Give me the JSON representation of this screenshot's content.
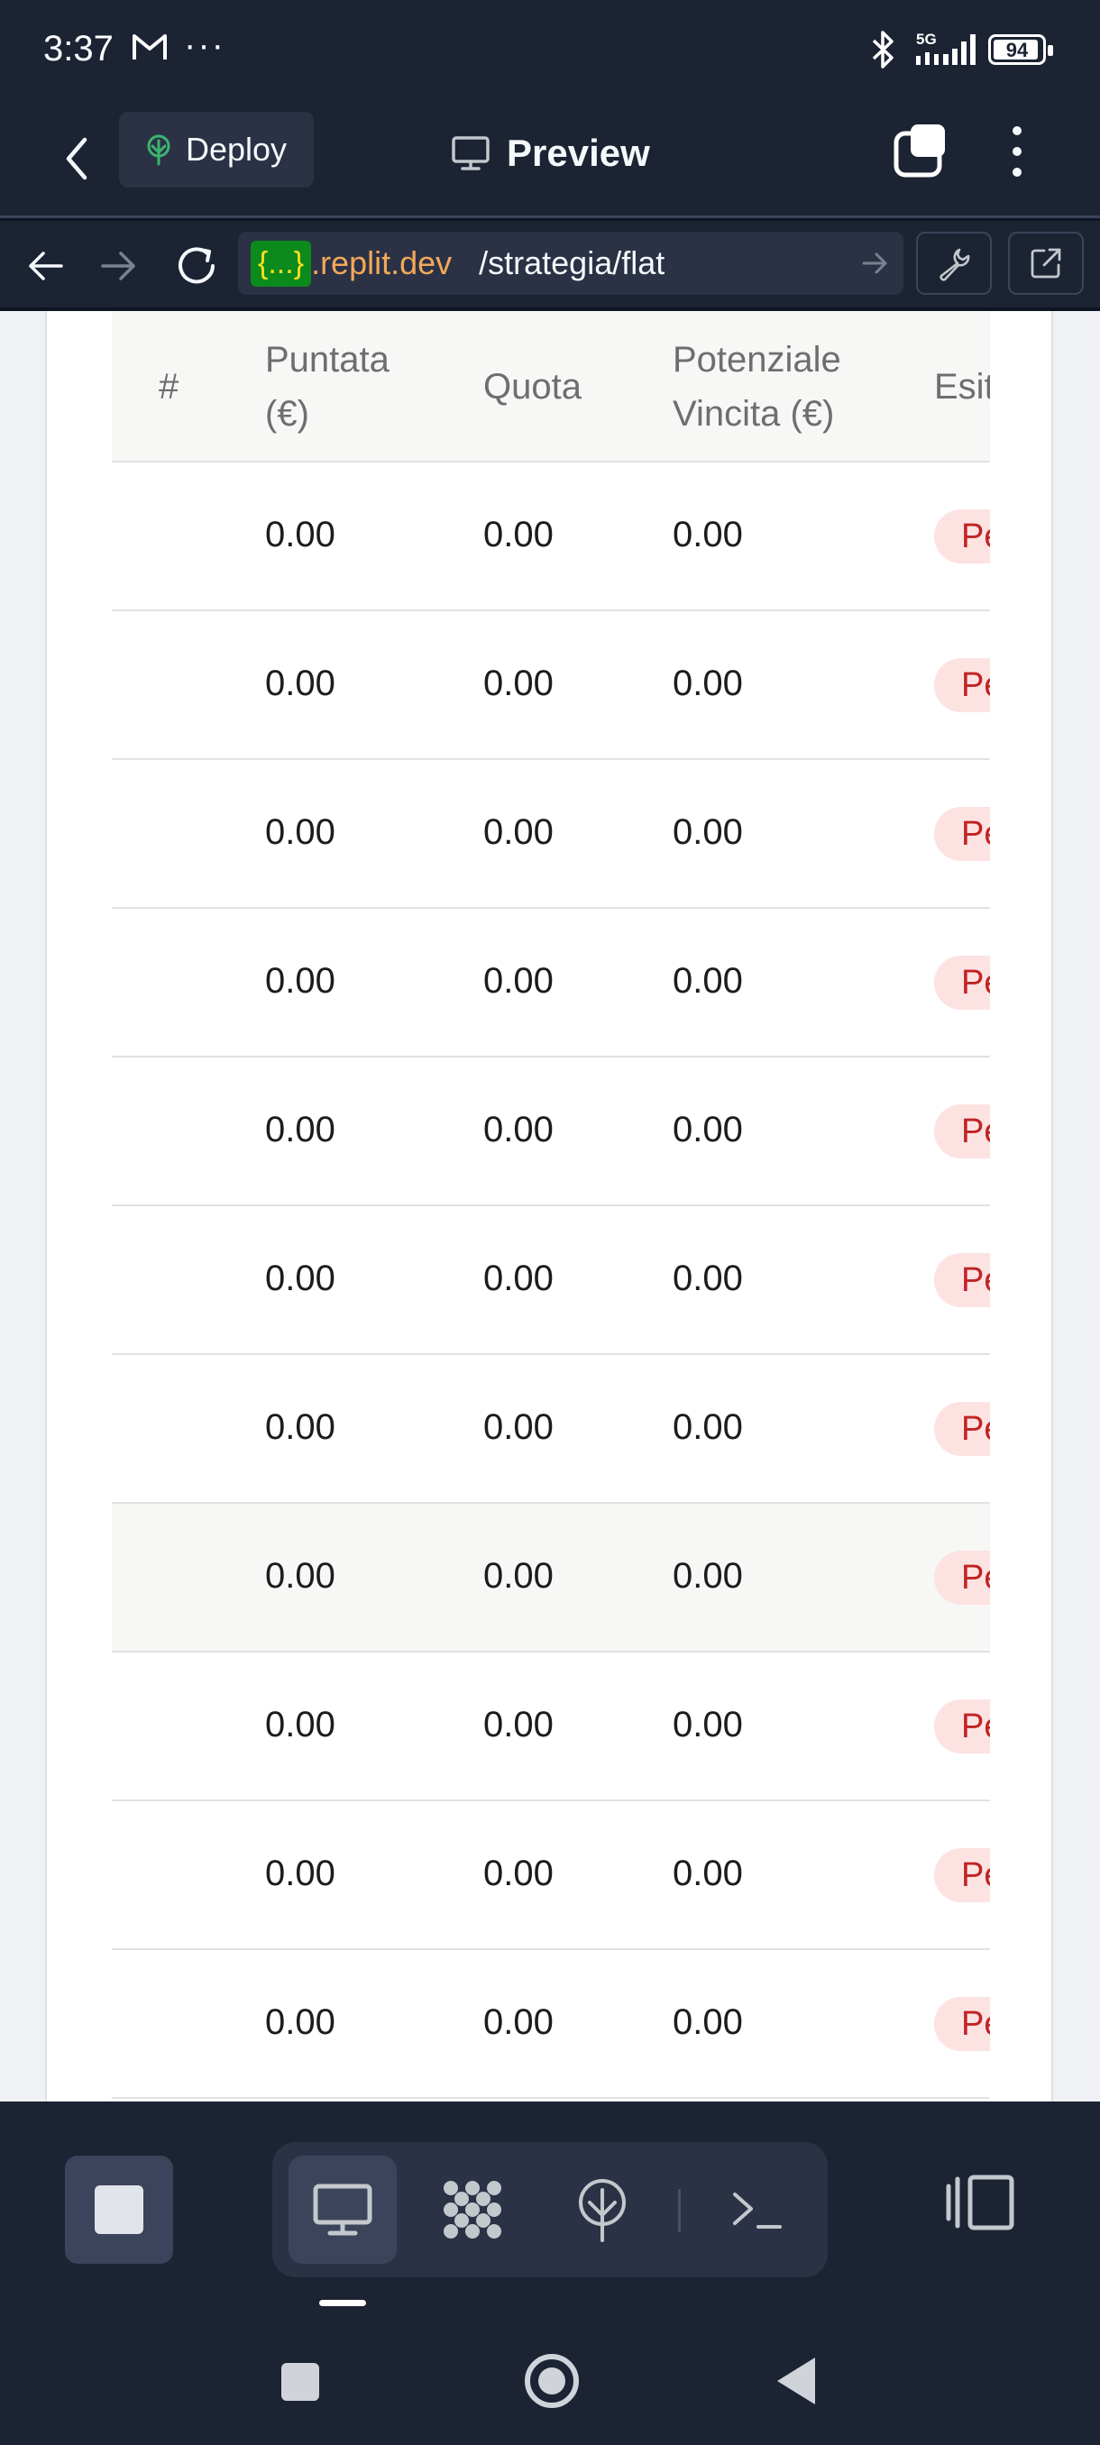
{
  "status": {
    "time": "3:37",
    "network": "5G",
    "battery": "94",
    "battery_level": 0.94
  },
  "header": {
    "deploy_label": "Deploy",
    "title": "Preview"
  },
  "url_bar": {
    "badge": "{...}",
    "host": ".replit.dev",
    "path": "/strategia/flat"
  },
  "table": {
    "columns": {
      "hash": "#",
      "stake_line1": "Puntata",
      "stake_line2": "(€)",
      "odds": "Quota",
      "win_line1": "Potenziale",
      "win_line2": "Vincita (€)",
      "outcome": "Esit"
    },
    "rows": [
      {
        "stake": "0.00",
        "odds": "0.00",
        "win": "0.00",
        "outcome": "Pe"
      },
      {
        "stake": "0.00",
        "odds": "0.00",
        "win": "0.00",
        "outcome": "Pe"
      },
      {
        "stake": "0.00",
        "odds": "0.00",
        "win": "0.00",
        "outcome": "Pe"
      },
      {
        "stake": "0.00",
        "odds": "0.00",
        "win": "0.00",
        "outcome": "Pe"
      },
      {
        "stake": "0.00",
        "odds": "0.00",
        "win": "0.00",
        "outcome": "Pe"
      },
      {
        "stake": "0.00",
        "odds": "0.00",
        "win": "0.00",
        "outcome": "Pe"
      },
      {
        "stake": "0.00",
        "odds": "0.00",
        "win": "0.00",
        "outcome": "Pe"
      },
      {
        "stake": "0.00",
        "odds": "0.00",
        "win": "0.00",
        "outcome": "Pe"
      },
      {
        "stake": "0.00",
        "odds": "0.00",
        "win": "0.00",
        "outcome": "Pe"
      },
      {
        "stake": "0.00",
        "odds": "0.00",
        "win": "0.00",
        "outcome": "Pe"
      },
      {
        "stake": "0.00",
        "odds": "0.00",
        "win": "0.00",
        "outcome": "Pe"
      }
    ]
  },
  "toolbar": {
    "items": [
      "stop-icon",
      "monitor-icon",
      "agent-icon",
      "deploy-icon",
      "terminal-icon",
      "panel-icon"
    ]
  },
  "colors": {
    "chrome_bg": "#1c2333",
    "url_host": "#f3a85a",
    "url_badge_bg": "#0c8a1c",
    "badge_bg": "#fde2e2",
    "badge_text": "#c02424"
  }
}
